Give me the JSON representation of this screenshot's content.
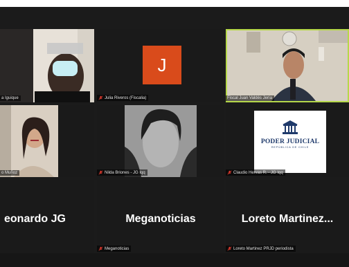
{
  "participants": [
    {
      "name": "a Iguique",
      "muted": false,
      "kind": "video"
    },
    {
      "name": "Julia Riveros (Fiscalia)",
      "muted": true,
      "kind": "avatar",
      "initial": "J",
      "avatar_color": "#d94b1b"
    },
    {
      "name": "Fiscal Juan Valdés Jería",
      "muted": false,
      "kind": "video",
      "active_speaker": true
    },
    {
      "name": "o Muñoz",
      "muted": false,
      "kind": "video"
    },
    {
      "name": "Nilda Briones - JG Iqq",
      "muted": true,
      "kind": "video"
    },
    {
      "name": "Claudio Hervas R. - JG Iqq",
      "muted": true,
      "kind": "logo",
      "logo_title": "PODER JUDICIAL",
      "logo_subtitle": "REPÚBLICA DE CHILE"
    },
    {
      "name": "",
      "muted": false,
      "kind": "name",
      "display": "eonardo JG"
    },
    {
      "name": "Meganoticias",
      "muted": true,
      "kind": "name",
      "display": "Meganoticias"
    },
    {
      "name": "Loreto Martinez PRJD periodista",
      "muted": true,
      "kind": "name",
      "display": "Loreto Martinez..."
    }
  ],
  "colors": {
    "background": "#1b1b1b",
    "tile": "#1a1a1a",
    "active_border": "#b6d84a",
    "mic_off": "#e23a2e"
  },
  "icons": {
    "mic_off": "mic-off-icon"
  }
}
